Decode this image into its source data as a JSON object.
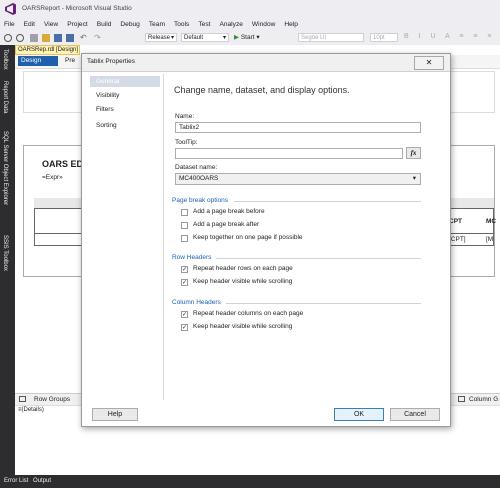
{
  "window": {
    "title": "OARSReport - Microsoft Visual Studio"
  },
  "menu": [
    "File",
    "Edit",
    "View",
    "Project",
    "Build",
    "Debug",
    "Team",
    "Tools",
    "Test",
    "Analyze",
    "Window",
    "Help"
  ],
  "toolbar": {
    "config": "Release",
    "platform": "Default",
    "start": "Start",
    "font": "Segoe UI",
    "size": "10pt"
  },
  "side_tabs": [
    "Toolbox",
    "Report Data",
    "SQL Server Object Explorer",
    "SSIS Toolbox"
  ],
  "document": {
    "tab": "OARSRep.rdl [Design]",
    "design_label": "Design",
    "preview_label": "Pre",
    "report_title": "OARS EDI",
    "expr": "=Expr»",
    "col_cpt": "CPT",
    "col_mc": "MC",
    "cell_cpt": "[CPT]",
    "cell_mc": "[M"
  },
  "groups": {
    "row_groups": "Row Groups",
    "details": "≡(Details)",
    "column_groups": "Column G"
  },
  "status": {
    "error_list": "Error List",
    "output": "Output"
  },
  "dialog": {
    "title": "Tablix Properties",
    "close": "✕",
    "nav": [
      "General",
      "Visibility",
      "Filters",
      "Sorting"
    ],
    "heading": "Change name, dataset, and display options.",
    "name_label": "Name:",
    "name_value": "Tablix2",
    "tooltip_label": "ToolTip:",
    "tooltip_value": "",
    "fx": "fx",
    "dataset_label": "Dataset name:",
    "dataset_value": "MC400OARS",
    "page_break": {
      "title": "Page break options",
      "items": [
        "Add a page break before",
        "Add a page break after",
        "Keep together on one page if possible"
      ]
    },
    "row_headers": {
      "title": "Row Headers",
      "items": [
        "Repeat header rows on each page",
        "Keep header visible while scrolling"
      ]
    },
    "column_headers": {
      "title": "Column Headers",
      "items": [
        "Repeat header columns on each page",
        "Keep header visible while scrolling"
      ]
    },
    "help": "Help",
    "ok": "OK",
    "cancel": "Cancel"
  }
}
